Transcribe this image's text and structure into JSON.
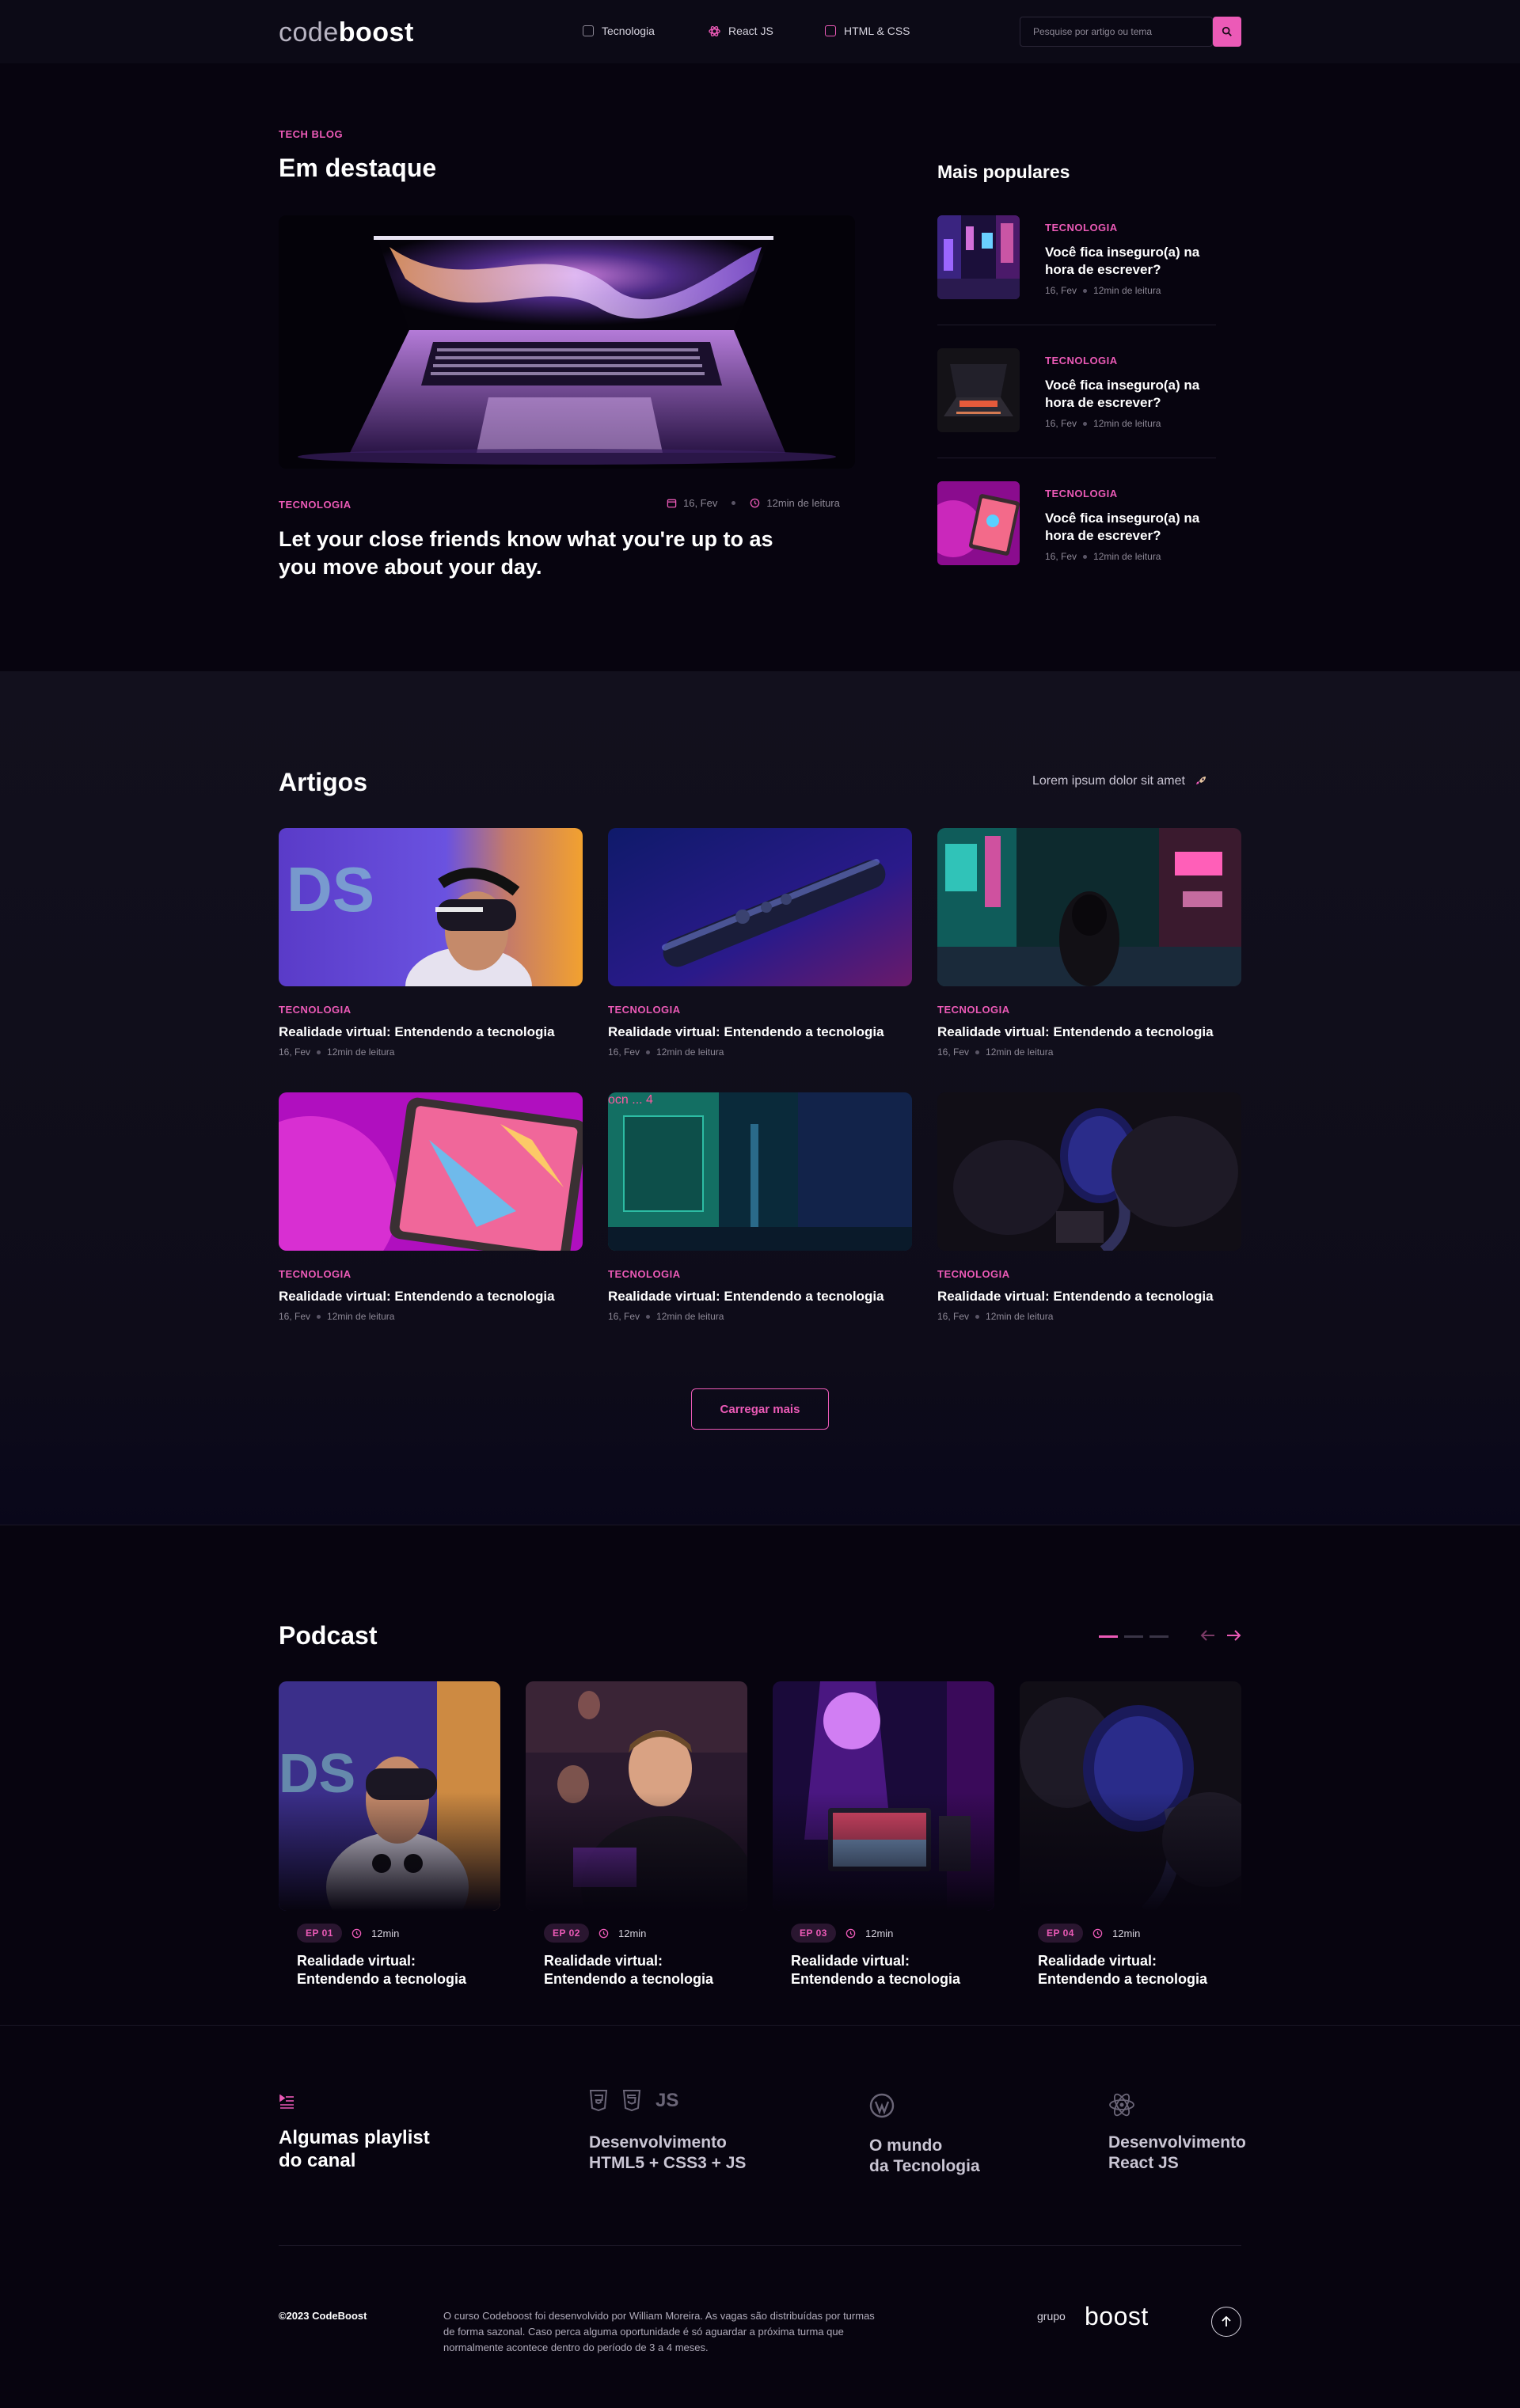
{
  "header": {
    "logo": {
      "part1": "code",
      "part2": "boost"
    },
    "nav": [
      {
        "label": "Tecnologia",
        "icon": "screen-icon"
      },
      {
        "label": "React JS",
        "icon": "atom-icon"
      },
      {
        "label": "HTML & CSS",
        "icon": "code-icon"
      }
    ],
    "search": {
      "placeholder": "Pesquise por artigo ou tema",
      "value": ""
    }
  },
  "featured": {
    "kicker": "TECH BLOG",
    "heading": "Em destaque",
    "category": "TECNOLOGIA",
    "date": "16, Fev",
    "read_time": "12min de leitura",
    "title_line1": "Let your close friends know what you're up to as",
    "title_line2": "you move about your day."
  },
  "popular": {
    "heading": "Mais populares",
    "items": [
      {
        "category": "TECNOLOGIA",
        "title_line1": "Você fica inseguro(a) na",
        "title_line2": "hora de escrever?",
        "date": "16, Fev",
        "read_time": "12min de leitura"
      },
      {
        "category": "TECNOLOGIA",
        "title_line1": "Você fica inseguro(a) na",
        "title_line2": "hora de escrever?",
        "date": "16, Fev",
        "read_time": "12min de leitura"
      },
      {
        "category": "TECNOLOGIA",
        "title_line1": "Você fica inseguro(a) na",
        "title_line2": "hora de escrever?",
        "date": "16, Fev",
        "read_time": "12min de leitura"
      }
    ]
  },
  "articles": {
    "heading": "Artigos",
    "tagline": "Lorem ipsum dolor sit amet",
    "items": [
      {
        "category": "TECNOLOGIA",
        "title": "Realidade virtual: Entendendo a tecnologia",
        "date": "16, Fev",
        "read_time": "12min de leitura"
      },
      {
        "category": "TECNOLOGIA",
        "title": "Realidade virtual: Entendendo a tecnologia",
        "date": "16, Fev",
        "read_time": "12min de leitura"
      },
      {
        "category": "TECNOLOGIA",
        "title": "Realidade virtual: Entendendo a tecnologia",
        "date": "16, Fev",
        "read_time": "12min de leitura"
      },
      {
        "category": "TECNOLOGIA",
        "title": "Realidade virtual: Entendendo a tecnologia",
        "date": "16, Fev",
        "read_time": "12min de leitura"
      },
      {
        "category": "TECNOLOGIA",
        "title": "Realidade virtual: Entendendo a tecnologia",
        "date": "16, Fev",
        "read_time": "12min de leitura"
      },
      {
        "category": "TECNOLOGIA",
        "title": "Realidade virtual: Entendendo a tecnologia",
        "date": "16, Fev",
        "read_time": "12min de leitura"
      }
    ],
    "load_more": "Carregar mais"
  },
  "podcast": {
    "heading": "Podcast",
    "episodes": [
      {
        "ep": "EP 01",
        "duration": "12min",
        "title_line1": "Realidade virtual:",
        "title_line2": "Entendendo a tecnologia"
      },
      {
        "ep": "EP 02",
        "duration": "12min",
        "title_line1": "Realidade virtual:",
        "title_line2": "Entendendo a tecnologia"
      },
      {
        "ep": "EP 03",
        "duration": "12min",
        "title_line1": "Realidade virtual:",
        "title_line2": "Entendendo a tecnologia"
      },
      {
        "ep": "EP 04",
        "duration": "12min",
        "title_line1": "Realidade virtual:",
        "title_line2": "Entendendo a tecnologia"
      }
    ]
  },
  "playlists": {
    "intro_line1": "Algumas playlist",
    "intro_line2": "do canal",
    "items": [
      {
        "line1": "Desenvolvimento",
        "line2": "HTML5 + CSS3 + JS",
        "js_label": "JS"
      },
      {
        "line1": "O mundo",
        "line2": "da Tecnologia"
      },
      {
        "line1": "Desenvolvimento",
        "line2": "React JS"
      }
    ]
  },
  "footer": {
    "copyright": "©2023 CodeBoost",
    "text_line1": "O curso Codeboost foi desenvolvido por William Moreira. As vagas são distribuídas por turmas",
    "text_line2": "de forma sazonal. Caso perca alguma oportunidade é só aguardar a próxima turma que",
    "text_line3": "normalmente acontece dentro do período de 3 a 4 meses.",
    "brand_prefix": "grupo",
    "brand_name": "boost"
  },
  "colors": {
    "accent": "#ec5ab7",
    "background": "#07040f",
    "section_alt": "#12101d"
  }
}
